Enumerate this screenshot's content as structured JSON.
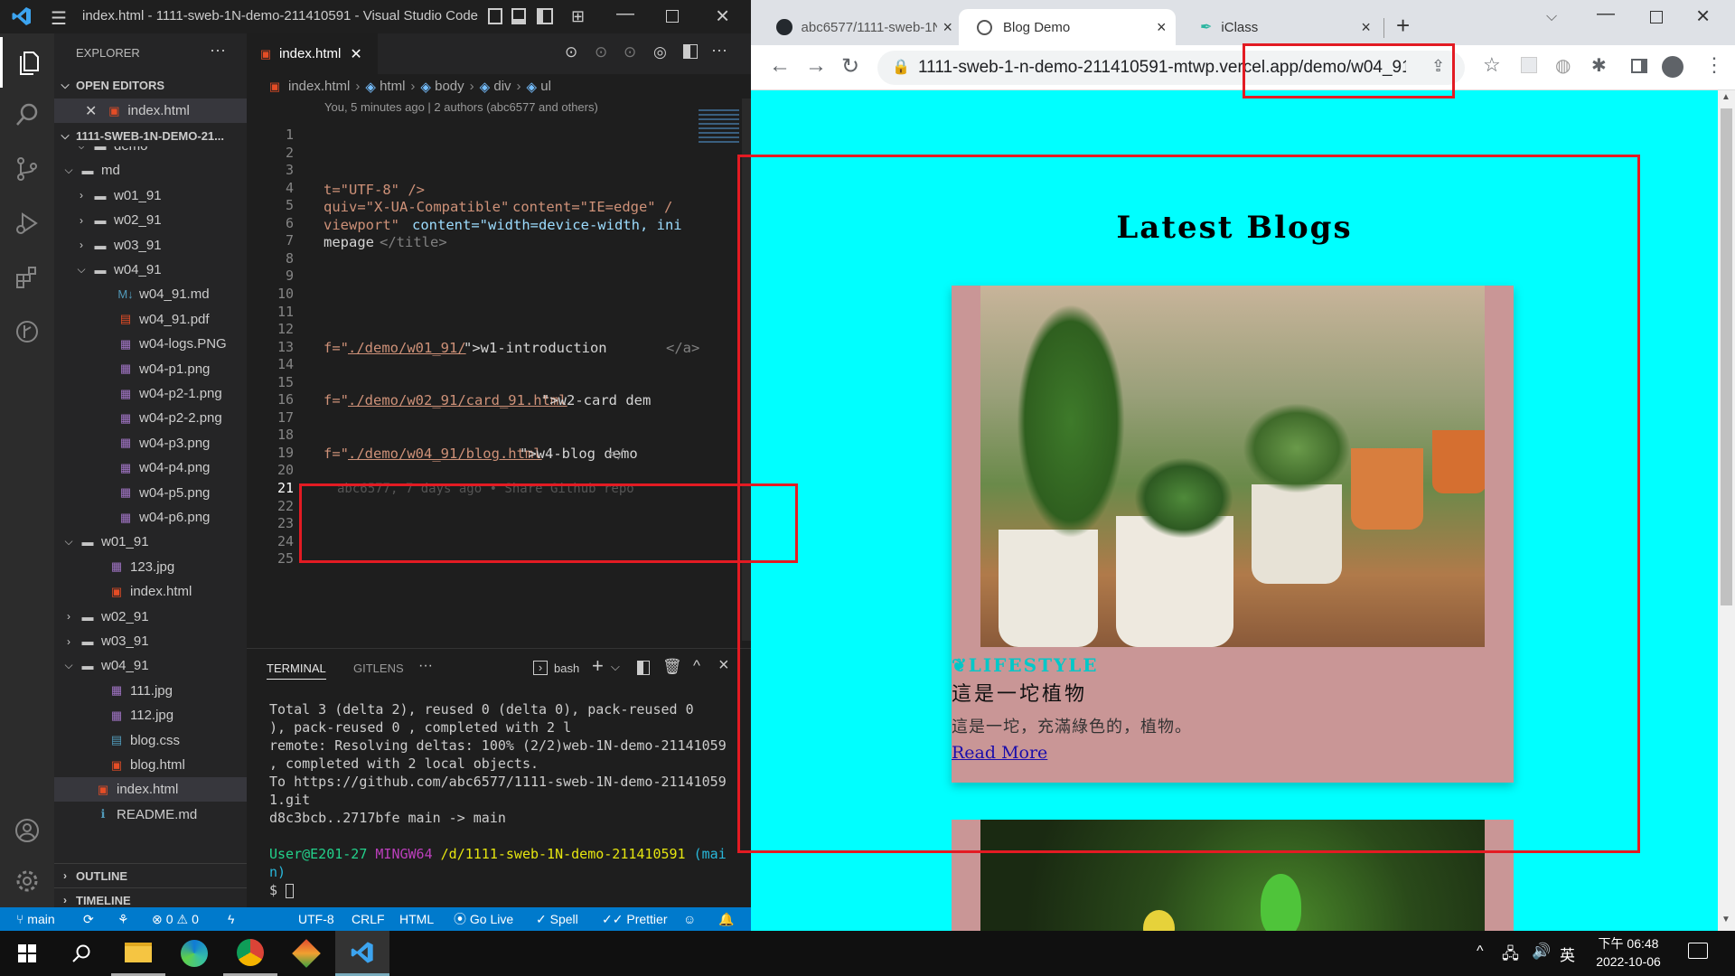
{
  "vscode": {
    "window_title": "index.html - 1111-sweb-1N-demo-211410591 - Visual Studio Code",
    "explorer_label": "EXPLORER",
    "open_editors_label": "OPEN EDITORS",
    "open_editor_file": "index.html",
    "repo_label": "1111-SWEB-1N-DEMO-21...",
    "tree": [
      {
        "label": "demo",
        "kind": "folder-open"
      },
      {
        "label": "md",
        "kind": "folder-open"
      },
      {
        "label": "w01_91",
        "kind": "folder"
      },
      {
        "label": "w02_91",
        "kind": "folder"
      },
      {
        "label": "w03_91",
        "kind": "folder"
      },
      {
        "label": "w04_91",
        "kind": "folder-open"
      },
      {
        "label": "w04_91.md",
        "kind": "md"
      },
      {
        "label": "w04_91.pdf",
        "kind": "pdf"
      },
      {
        "label": "w04-logs.PNG",
        "kind": "img"
      },
      {
        "label": "w04-p1.png",
        "kind": "img"
      },
      {
        "label": "w04-p2-1.png",
        "kind": "img"
      },
      {
        "label": "w04-p2-2.png",
        "kind": "img"
      },
      {
        "label": "w04-p3.png",
        "kind": "img"
      },
      {
        "label": "w04-p4.png",
        "kind": "img"
      },
      {
        "label": "w04-p5.png",
        "kind": "img"
      },
      {
        "label": "w04-p6.png",
        "kind": "img"
      },
      {
        "label": "w01_91",
        "kind": "folder-open"
      },
      {
        "label": "123.jpg",
        "kind": "img"
      },
      {
        "label": "index.html",
        "kind": "html"
      },
      {
        "label": "w02_91",
        "kind": "folder"
      },
      {
        "label": "w03_91",
        "kind": "folder"
      },
      {
        "label": "w04_91",
        "kind": "folder-open"
      },
      {
        "label": "111.jpg",
        "kind": "img"
      },
      {
        "label": "112.jpg",
        "kind": "img"
      },
      {
        "label": "blog.css",
        "kind": "css"
      },
      {
        "label": "blog.html",
        "kind": "html"
      },
      {
        "label": "index.html",
        "kind": "html"
      },
      {
        "label": "README.md",
        "kind": "info"
      }
    ],
    "outline_label": "OUTLINE",
    "timeline_label": "TIMELINE",
    "editor_tab": "index.html",
    "breadcrumb": [
      "index.html",
      "html",
      "body",
      "div",
      "ul"
    ],
    "blame_header": "You, 5 minutes ago | 2 authors (abc6577 and others)",
    "line_numbers": [
      "1",
      "2",
      "3",
      "4",
      "5",
      "6",
      "7",
      "8",
      "9",
      "10",
      "11",
      "12",
      "13",
      "14",
      "15",
      "16",
      "17",
      "18",
      "19",
      "20",
      "21",
      "22",
      "23",
      "24",
      "25"
    ],
    "code": {
      "l4": "t=\"UTF-8\" />",
      "l5a": "quiv=\"X-UA-Compatible\"",
      "l5b": "content=\"IE=edge\" /",
      "l6a": "viewport\"",
      "l6b": "content=\"width=device-width, ini",
      "l7a": "mepage",
      "l7b": "</title>",
      "l13a": "f=\"",
      "l13b": "./demo/w01_91/",
      "l13c": "\">w1-introduction",
      "l13d": "</a>",
      "l16a": "f=\"",
      "l16b": "./demo/w02_91/card_91.html",
      "l16c": "\">w2-card dem",
      "l19a": "f=\"",
      "l19b": "./demo/w04_91/blog.html",
      "l19c": "\">w4-blog demo",
      "l19d": "</",
      "l21": "abc6577, 7 days ago • Share Github repo"
    },
    "panel_tabs": [
      "TERMINAL",
      "GITLENS",
      "···"
    ],
    "shell_label": "bash",
    "terminal": [
      "Total 3 (delta 2), reused 0 (delta 0), pack-reused 0",
      "), pack-reused 0                     , completed with 2 l",
      "remote: Resolving deltas: 100% (2/2)web-1N-demo-21141059",
      ", completed with 2 local objects.",
      "To https://github.com/abc6577/1111-sweb-1N-demo-21141059",
      "1.git",
      "   d8c3bcb..2717bfe  main -> main"
    ],
    "prompt_user": "User@E201-27",
    "prompt_shell": "MINGW64",
    "prompt_path": "/d/1111-sweb-1N-demo-211410591",
    "prompt_branch_a": "(mai",
    "prompt_branch_b": "n)",
    "prompt_symbol": "$",
    "status": {
      "branch": "main",
      "errors": "0",
      "warnings": "0",
      "encoding": "UTF-8",
      "eol": "CRLF",
      "language": "HTML",
      "golive": "Go Live",
      "spell": "Spell",
      "prettier": "Prettier"
    }
  },
  "chrome": {
    "tabs": [
      {
        "label": "abc6577/1111-sweb-1N"
      },
      {
        "label": "Blog Demo"
      },
      {
        "label": "iClass"
      }
    ],
    "url": "1111-sweb-1-n-demo-211410591-mtwp.vercel.app/demo/w04_91/...",
    "page_title": "Latest Blogs",
    "card": {
      "category": "LIFESTYLE",
      "title": "這是一坨植物",
      "description": "這是一坨，充滿綠色的，植物。",
      "link": "Read More"
    }
  },
  "taskbar": {
    "time": "下午 06:48",
    "date": "2022-10-06",
    "ime": "英"
  },
  "colors": {
    "vscode_status": "#007acc",
    "page_bg": "#00ffff",
    "card_bg": "#c99696",
    "category": "#00c8c8",
    "highlight": "#e31b23"
  }
}
